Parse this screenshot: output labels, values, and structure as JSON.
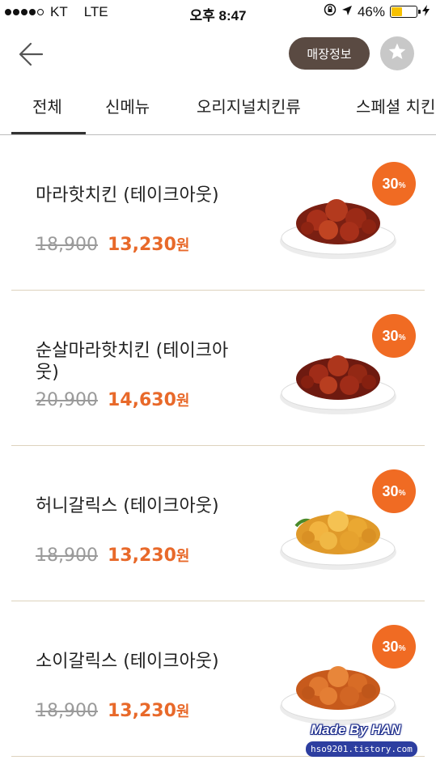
{
  "status_bar": {
    "carrier": "KT",
    "network": "LTE",
    "time": "오후 8:47",
    "battery_percent": "46%",
    "battery_level": 0.46,
    "signal_bars": 4,
    "signal_total": 5
  },
  "header": {
    "back_icon": "arrow-left-icon",
    "store_info_label": "매장정보",
    "favorite_icon": "star-icon"
  },
  "tabs": [
    {
      "label": "전체",
      "active": true
    },
    {
      "label": "신메뉴",
      "active": false
    },
    {
      "label": "오리지널치킨류",
      "active": false
    },
    {
      "label": "스페셜 치킨",
      "active": false
    }
  ],
  "menu_items": [
    {
      "name": "마라핫치킨 (테이크아웃)",
      "original_price": "18,900",
      "sale_price": "13,230",
      "currency": "원",
      "discount": "30",
      "discount_unit": "%",
      "image": "red-spicy-chicken"
    },
    {
      "name": "순살마라핫치킨 (테이크아웃)",
      "original_price": "20,900",
      "sale_price": "14,630",
      "currency": "원",
      "discount": "30",
      "discount_unit": "%",
      "image": "red-spicy-chicken"
    },
    {
      "name": "허니갈릭스 (테이크아웃)",
      "original_price": "18,900",
      "sale_price": "13,230",
      "currency": "원",
      "discount": "30",
      "discount_unit": "%",
      "image": "honey-garlic-chicken"
    },
    {
      "name": "소이갈릭스 (테이크아웃)",
      "original_price": "18,900",
      "sale_price": "13,230",
      "currency": "원",
      "discount": "30",
      "discount_unit": "%",
      "image": "soy-garlic-chicken"
    }
  ],
  "watermark": {
    "line1": "Made By HAN",
    "line2": "hso9201.tistory.com"
  },
  "colors": {
    "accent_orange": "#f06b23",
    "sale_price": "#e8692a",
    "store_button": "#5a4a42",
    "favorite_button": "#c8c8c8",
    "battery_fill": "#f7c100"
  }
}
